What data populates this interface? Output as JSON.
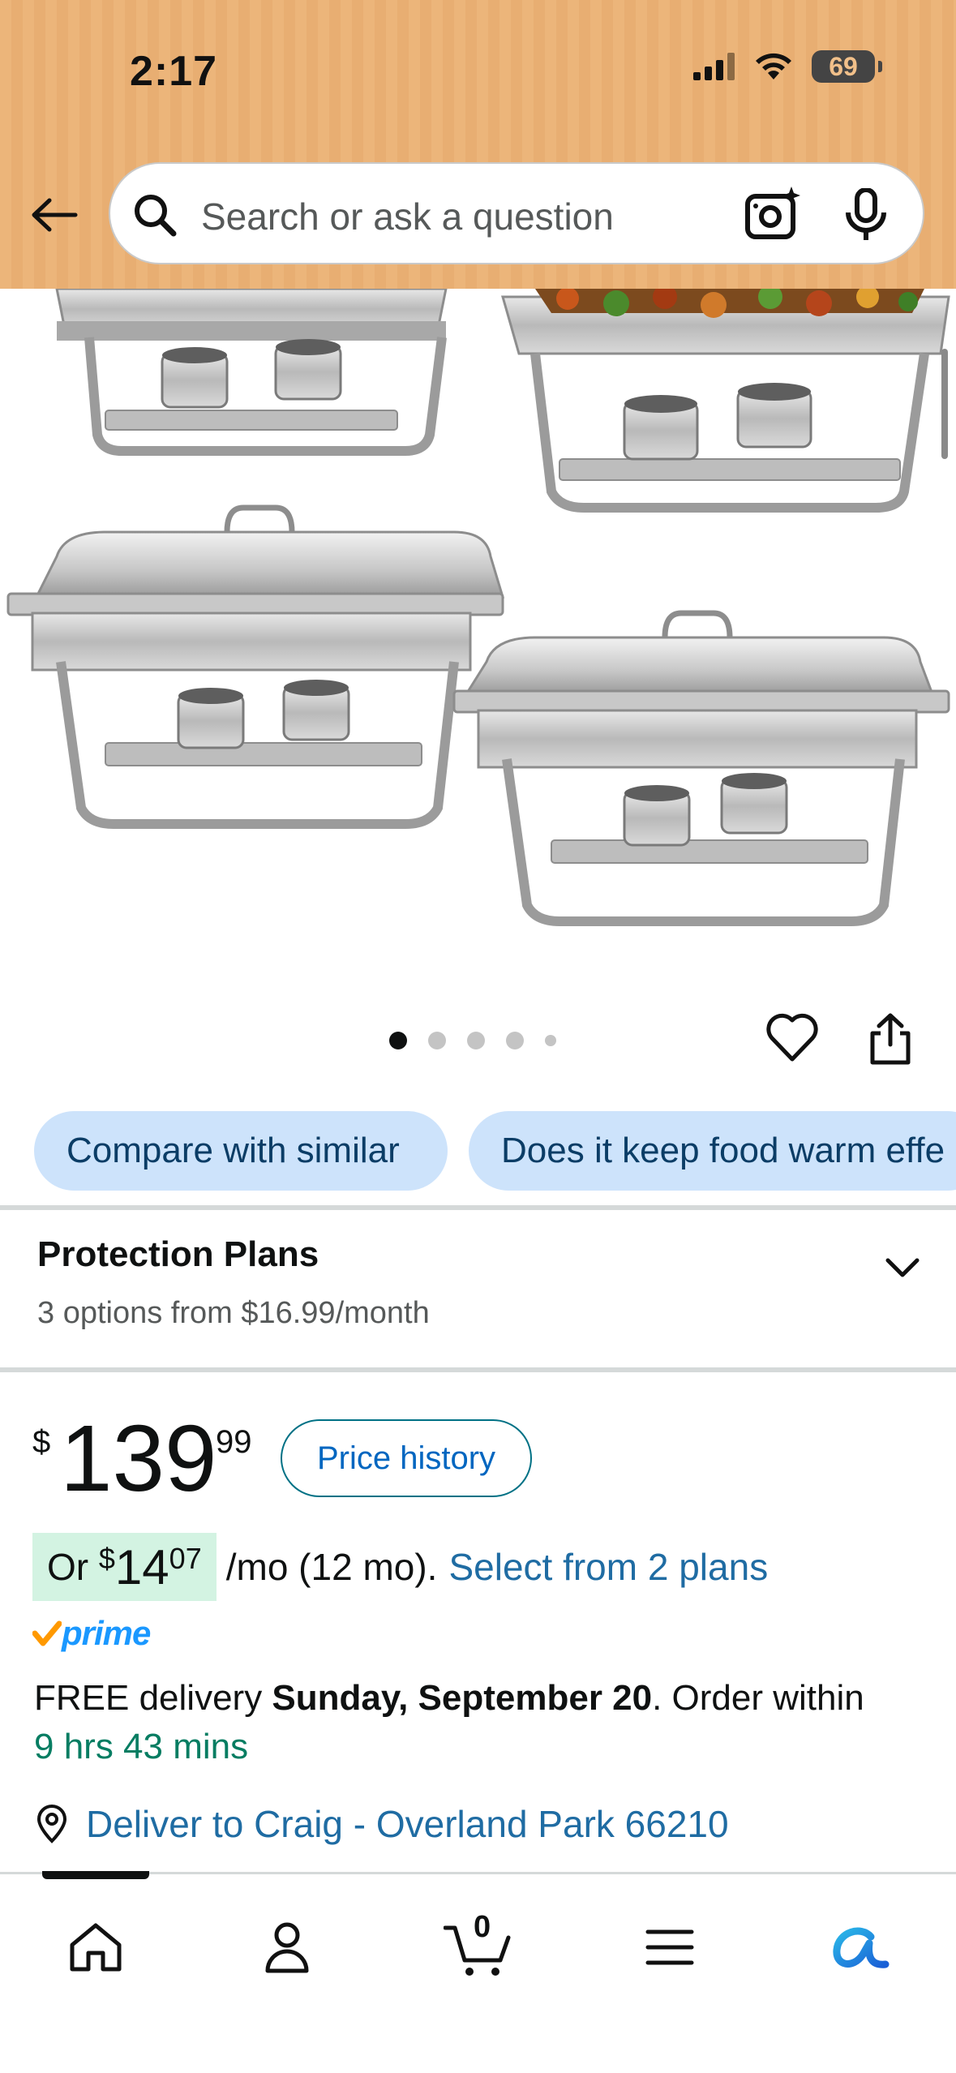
{
  "status_bar": {
    "time": "2:17",
    "battery": "69"
  },
  "header": {
    "search_placeholder": "Search or ask a question",
    "icons": [
      "back-arrow-icon",
      "search-icon",
      "camera-icon",
      "microphone-icon"
    ],
    "background_color": "#ecb57a"
  },
  "carousel": {
    "dots_total": 5,
    "active_index": 0,
    "actions": [
      "heart-icon",
      "share-icon"
    ]
  },
  "chips": [
    {
      "label": "Compare with similar"
    },
    {
      "label": "Does it keep food warm effe"
    }
  ],
  "protection_plans": {
    "title": "Protection Plans",
    "subtitle": "3 options from $16.99/month"
  },
  "price": {
    "symbol": "$",
    "whole": "139",
    "fraction": "99",
    "history_button": "Price history"
  },
  "installment": {
    "prefix": "Or ",
    "symbol": "$",
    "whole": "14",
    "fraction": "07",
    "terms": "/mo (12 mo).",
    "link": "Select from 2 plans"
  },
  "prime": {
    "label": "prime",
    "check_color": "#ff9900",
    "text_color": "#1a98ff"
  },
  "delivery": {
    "prefix": "FREE delivery ",
    "date": "Sunday, September 20",
    "middle": ". Order within ",
    "countdown": "9 hrs 43 mins"
  },
  "deliver_to": {
    "label": "Deliver to Craig - Overland Park 66210"
  },
  "bottom_nav": {
    "items": [
      "home-icon",
      "account-icon",
      "cart-icon",
      "menu-icon",
      "rufus-icon"
    ],
    "cart_count": "0"
  }
}
